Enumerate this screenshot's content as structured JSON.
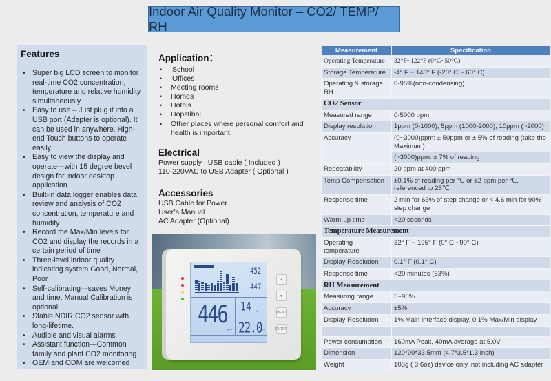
{
  "header": {
    "title": "Indoor Air Quality Monitor – CO2/ TEMP/ RH"
  },
  "features": {
    "heading": "Features",
    "items": [
      "Super big LCD screen to monitor real-time CO2 concentration, temperature and relative humidity simultaneously",
      "Easy to use – Just plug it into a USB port (Adapter is optional).  It can be used in anywhere.  High-end Touch buttons to operate easily.",
      "Easy to view the display and operate—with 15 degree bevel design for indoor desktop application",
      "Built-in data logger enables data review and analysis of CO2 concentration, temperature and humidity",
      "Record the Max/Min levels for CO2 and display the records in a certain period of time",
      "Three-level indoor quality indicating system Good, Normal, Poor",
      "Self-calibrating—saves Money and time.  Manual Calibration is optional.",
      "Stable NDIR CO2 sensor with long-lifetime.",
      "Audible and visual alarms",
      "Assistant function—Common family and plant CO2 monitoring.",
      "OEM and ODM are welcomed"
    ]
  },
  "application": {
    "heading": "Application：",
    "items": [
      "School",
      "Offices",
      "Meeting rooms",
      "Homes",
      "Hotels",
      "Hopstibal",
      "Other places where personal comfort and health is important."
    ]
  },
  "electrical": {
    "heading": "Electrical",
    "lines": [
      "Power supply : USB cable ( Included )",
      "110-220VAC to USB Adapter ( Optional )"
    ]
  },
  "accessories": {
    "heading": "Accessories",
    "lines": [
      "USB Cable for Power",
      "User’s Manual",
      "AC Adapter (Optional)"
    ]
  },
  "device_display": {
    "co2": "446",
    "rh": "14",
    "temp": "22.0",
    "max": "452",
    "min": "447",
    "co2_unit": "ppm",
    "rh_unit": "%",
    "temp_unit": "°C",
    "buttons": [
      "▲",
      "▼",
      "MENU",
      "ENTER"
    ],
    "led_colors": [
      "#d9302a",
      "#d9302a",
      "#e8e070",
      "#3fbf3f"
    ],
    "bar_levels": [
      0.55,
      0.5,
      0.45,
      0.4,
      0.35,
      0.4,
      0.3,
      0.5,
      1.0,
      0.45,
      0.85,
      0.3,
      0.7,
      0.4
    ]
  },
  "spec_table": {
    "headers": [
      "Measurement",
      "Specification"
    ],
    "rows": [
      {
        "type": "row",
        "label": "Operating Temperature",
        "value": "32°F~122°F (0°C~50°C)",
        "serif": true
      },
      {
        "type": "row",
        "label": "Storage Temperature",
        "value": "-4° F ~ 140° F (-20° C ~ 60° C)"
      },
      {
        "type": "row",
        "label": "Operating & storage RH",
        "value": "0-95%(non-condensing)"
      },
      {
        "type": "section",
        "label": "CO2 Sensor"
      },
      {
        "type": "row",
        "label": "Measured range",
        "value": "0-5000 ppm"
      },
      {
        "type": "row",
        "label": "Display resolution",
        "value": "1ppm (0-1000);  5ppm (1000-2000); 10ppm (>2000)"
      },
      {
        "type": "row",
        "label": "Accuracy",
        "value": "(0~3000)ppm: ± 50ppm or ± 5% of reading (take the Maximum)",
        "rowspan": 2
      },
      {
        "type": "cont",
        "value": "(>3000)ppm:  ± 7% of reading"
      },
      {
        "type": "row",
        "label": "Repeatability",
        "value": "20 ppm at 400 ppm"
      },
      {
        "type": "row",
        "label": "Temp Compensation",
        "value": "±0.1% of reading per ℃ or ±2 ppm per ℃, referenced to 25℃"
      },
      {
        "type": "row",
        "label": "Response time",
        "value": " 2 min for 63% of step change or < 4.6 min for 90% step change"
      },
      {
        "type": "row",
        "label": "Warm-up time",
        "value": "<20 seconds"
      },
      {
        "type": "section",
        "label": "Temperature Measurement"
      },
      {
        "type": "row",
        "label": "Operating temperature",
        "value": "32° F ~ 195° F (0° C ~90° C)"
      },
      {
        "type": "row",
        "label": "Display Resolution",
        "value": "0.1° F (0.1° C)"
      },
      {
        "type": "row",
        "label": "Response time",
        "value": "<20 minutes (63%)"
      },
      {
        "type": "section",
        "label": "RH Measurement"
      },
      {
        "type": "row",
        "label": "Measuring range",
        "value": "5~95%"
      },
      {
        "type": "row",
        "label": "Accuracy",
        "value": "±5%"
      },
      {
        "type": "row",
        "label": "Display Resolution",
        "value": "1% Main interface display, 0.1% Max/Min display"
      },
      {
        "type": "row",
        "label": "",
        "value": ""
      },
      {
        "type": "row",
        "label": "Power consumption",
        "value": "160mA Peak, 40mA average at 5.0V"
      },
      {
        "type": "row",
        "label": "Dimension",
        "value": "120*90*33.5mm  (4.7*3.5*1.3 inch)"
      },
      {
        "type": "row",
        "label": "Weight",
        "value": "103g ( 3.6oz)  device only, not including AC adapter"
      }
    ]
  }
}
